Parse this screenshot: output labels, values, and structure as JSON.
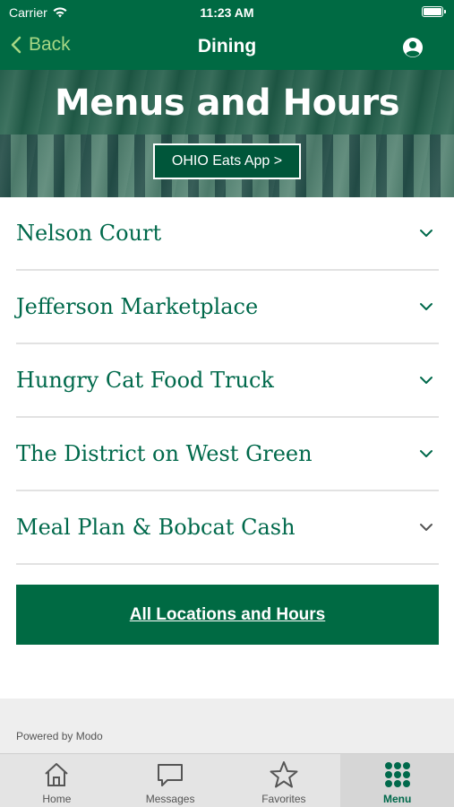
{
  "status": {
    "carrier": "Carrier",
    "time": "11:23 AM"
  },
  "nav": {
    "back_label": "Back",
    "title": "Dining"
  },
  "hero": {
    "heading": "Menus and Hours",
    "app_button_label": "OHIO Eats App >"
  },
  "locations": [
    {
      "label": "Nelson Court"
    },
    {
      "label": "Jefferson Marketplace"
    },
    {
      "label": "Hungry Cat Food Truck"
    },
    {
      "label": "The District on West Green"
    },
    {
      "label": "Meal Plan & Bobcat Cash"
    }
  ],
  "all_locations_label": "All Locations and Hours",
  "footer": {
    "powered_by": "Powered by Modo"
  },
  "tabs": [
    {
      "label": "Home",
      "icon": "home-icon"
    },
    {
      "label": "Messages",
      "icon": "messages-icon"
    },
    {
      "label": "Favorites",
      "icon": "star-icon"
    },
    {
      "label": "Menu",
      "icon": "grid-icon",
      "active": true
    }
  ],
  "colors": {
    "brand_green": "#006a43",
    "back_green": "#a6d785",
    "label_green": "#00694b"
  }
}
